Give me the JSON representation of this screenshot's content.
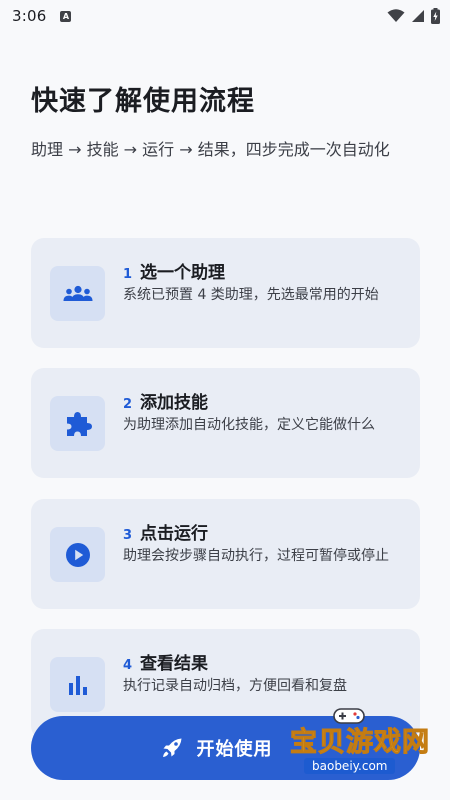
{
  "status_bar": {
    "time": "3:06",
    "notification_icon": "a-notification-icon",
    "wifi_icon": "wifi-icon",
    "signal_icon": "cell-signal-icon",
    "battery_icon": "battery-charging-icon"
  },
  "header": {
    "title": "快速了解使用流程",
    "subtitle": "助理 → 技能 → 运行 → 结果，四步完成一次自动化"
  },
  "steps": [
    {
      "number": "1",
      "title": "选一个助理",
      "description": "系统已预置 4 类助理，先选最常用的开始",
      "icon": "people-group-icon"
    },
    {
      "number": "2",
      "title": "添加技能",
      "description": "为助理添加自动化技能，定义它能做什么",
      "icon": "puzzle-piece-icon"
    },
    {
      "number": "3",
      "title": "点击运行",
      "description": "助理会按步骤自动执行，过程可暂停或停止",
      "icon": "play-circle-icon"
    },
    {
      "number": "4",
      "title": "查看结果",
      "description": "执行记录自动归档，方便回看和复盘",
      "icon": "bar-chart-icon"
    }
  ],
  "primary_action": {
    "label": "开始使用",
    "icon": "rocket-icon"
  },
  "watermark": {
    "text": "宝贝游戏网",
    "url": "baobeiy.com"
  },
  "colors": {
    "accent": "#2a5fd1",
    "step_number": "#1f5bd6",
    "card_bg": "#e9edf5",
    "icon_box_bg": "#d6e0f3",
    "page_bg": "#f8f9fb"
  }
}
